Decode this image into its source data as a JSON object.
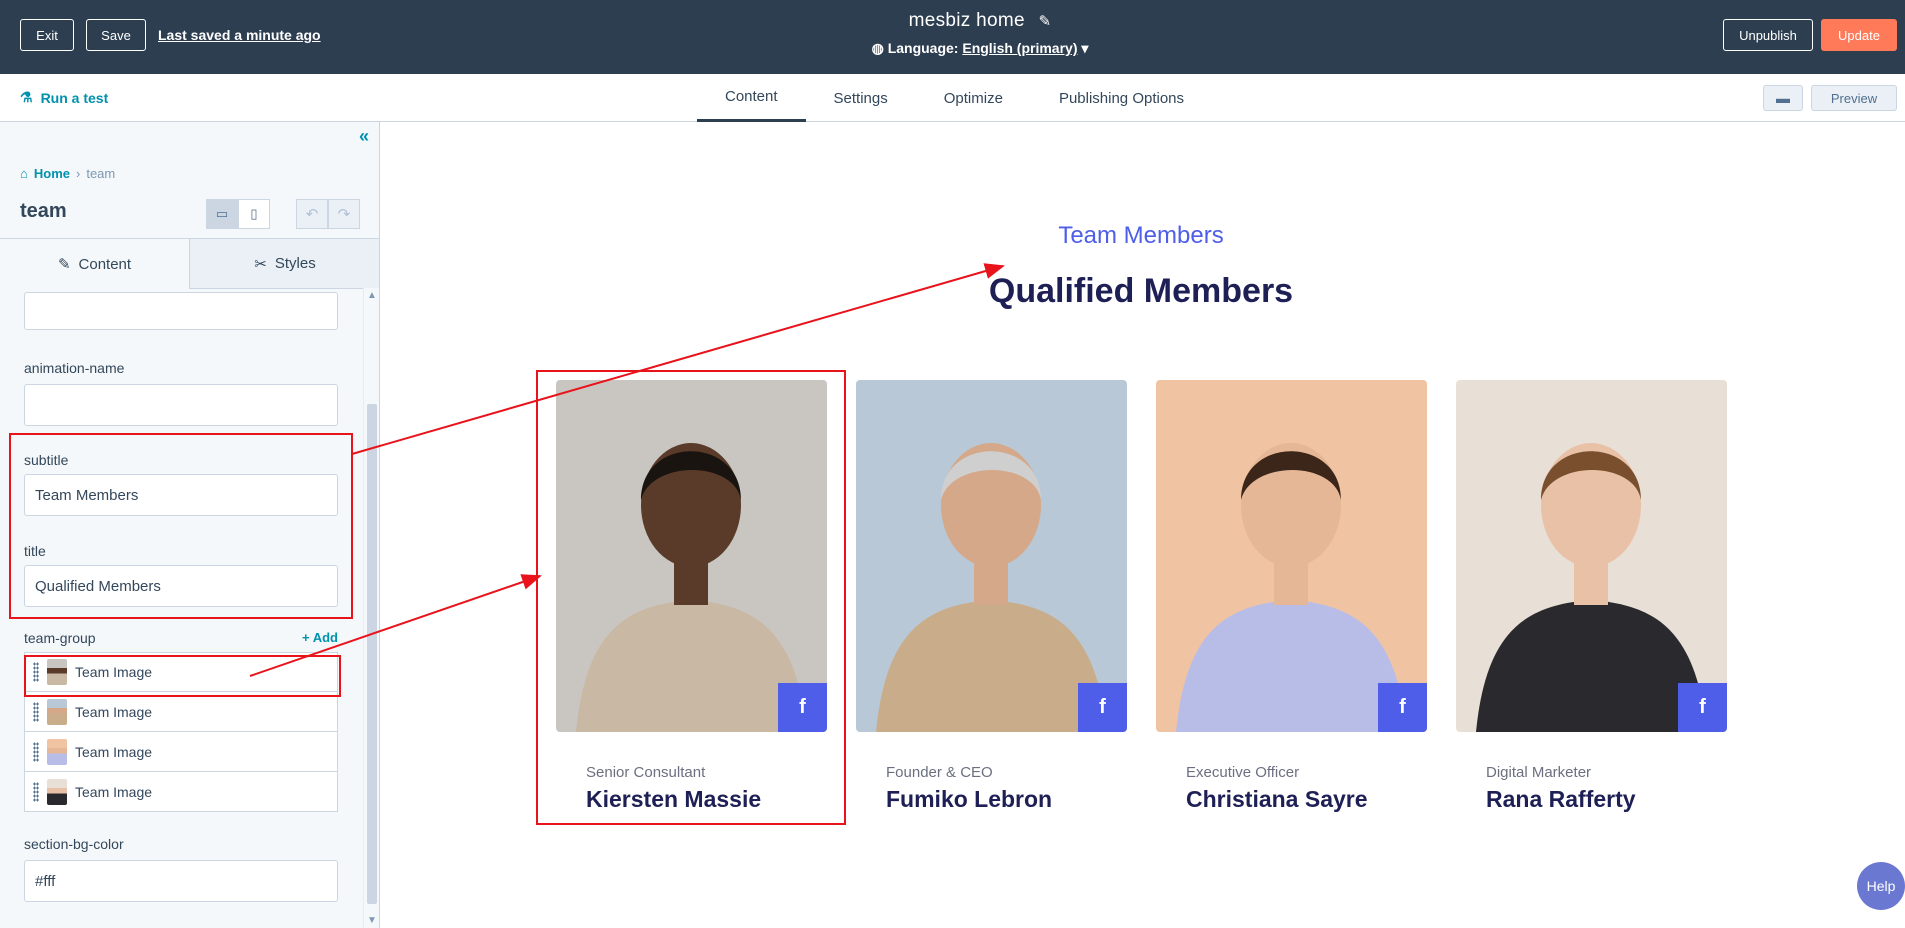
{
  "topbar": {
    "exit_label": "Exit",
    "save_label": "Save",
    "last_saved": "Last saved a minute ago",
    "page_title": "mesbiz home",
    "language_label": "Language:",
    "language_value": "English (primary)",
    "unpublish_label": "Unpublish",
    "update_label": "Update"
  },
  "subbar": {
    "run_test": "Run a test",
    "tabs": [
      "Content",
      "Settings",
      "Optimize",
      "Publishing Options"
    ],
    "active_tab": "Content",
    "preview_label": "Preview"
  },
  "panel": {
    "breadcrumb_home": "Home",
    "breadcrumb_current": "team",
    "module_name": "team",
    "tabs": {
      "content": "Content",
      "styles": "Styles"
    },
    "fields": {
      "animation_name_label": "animation-name",
      "animation_name_value": "",
      "subtitle_label": "subtitle",
      "subtitle_value": "Team Members",
      "title_label": "title",
      "title_value": "Qualified Members",
      "team_group_label": "team-group",
      "add_label": "+ Add",
      "team_items": [
        "Team Image",
        "Team Image",
        "Team Image",
        "Team Image"
      ],
      "section_bg_label": "section-bg-color",
      "section_bg_value": "#fff"
    }
  },
  "preview": {
    "subtitle": "Team Members",
    "title": "Qualified Members",
    "members": [
      {
        "role": "Senior Consultant",
        "name": "Kiersten Massie",
        "bg": "#c9c6c2",
        "coat": "#c8b8a4",
        "skin": "#5a3b2a",
        "hair": "#1a1410"
      },
      {
        "role": "Founder & CEO",
        "name": "Fumiko Lebron",
        "bg": "#b9c8d6",
        "coat": "#c9ad8a",
        "skin": "#d4a888",
        "hair": "#cfcfcf"
      },
      {
        "role": "Executive Officer",
        "name": "Christiana Sayre",
        "bg": "#f0c3a2",
        "coat": "#b8bde8",
        "skin": "#e6b796",
        "hair": "#3b2619"
      },
      {
        "role": "Digital Marketer",
        "name": "Rana Rafferty",
        "bg": "#e8dfd6",
        "coat": "#2a2a2e",
        "skin": "#e9c1a6",
        "hair": "#7a4f2e"
      }
    ],
    "fb_glyph": "f",
    "help_label": "Help"
  },
  "colors": {
    "topbar_bg": "#2d3e50",
    "update_btn": "#ff7a59",
    "accent_blue": "#4e5ee8",
    "title_navy": "#1e1f55",
    "annotation_red": "#e8131b"
  }
}
